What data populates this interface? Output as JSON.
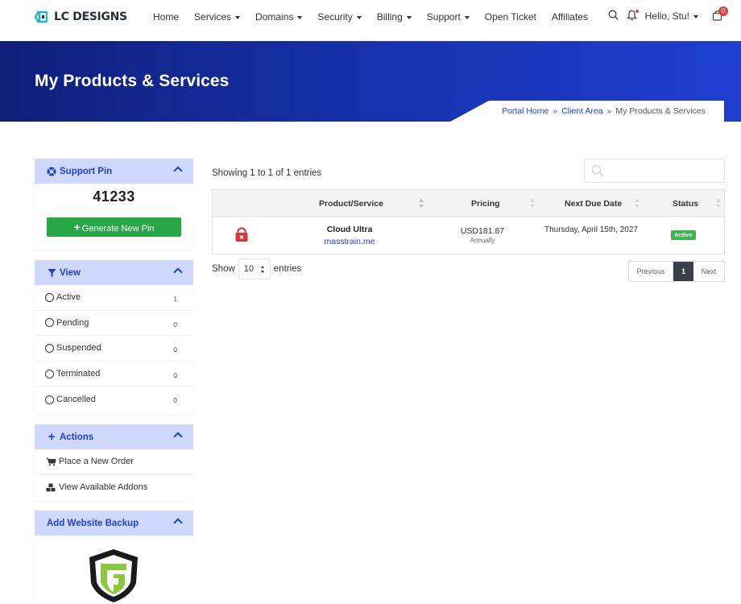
{
  "brand": {
    "name": "LC DESIGNS"
  },
  "nav": {
    "items": [
      {
        "label": "Home",
        "dropdown": false
      },
      {
        "label": "Services",
        "dropdown": true
      },
      {
        "label": "Domains",
        "dropdown": true
      },
      {
        "label": "Security",
        "dropdown": true
      },
      {
        "label": "Billing",
        "dropdown": true
      },
      {
        "label": "Support",
        "dropdown": true
      },
      {
        "label": "Open Ticket",
        "dropdown": false
      },
      {
        "label": "Affiliates",
        "dropdown": false
      }
    ],
    "greeting": "Hello, Stu!",
    "cart_count": "0"
  },
  "hero": {
    "title": "My Products & Services"
  },
  "breadcrumb": {
    "home": "Portal Home",
    "client_area": "Client Area",
    "current": "My Products & Services"
  },
  "sidebar": {
    "support_pin": {
      "title": "Support Pin",
      "value": "41233",
      "button": "Generate New Pin"
    },
    "view": {
      "title": "View",
      "items": [
        {
          "label": "Active",
          "count": "1"
        },
        {
          "label": "Pending",
          "count": "0"
        },
        {
          "label": "Suspended",
          "count": "0"
        },
        {
          "label": "Terminated",
          "count": "0"
        },
        {
          "label": "Cancelled",
          "count": "0"
        }
      ]
    },
    "actions": {
      "title": "Actions",
      "items": [
        {
          "label": "Place a New Order"
        },
        {
          "label": "View Available Addons"
        }
      ]
    },
    "backup": {
      "title": "Add Website Backup"
    }
  },
  "table": {
    "showing": "Showing 1 to 1 of 1 entries",
    "columns": {
      "product": "Product/Service",
      "pricing": "Pricing",
      "due": "Next Due Date",
      "status": "Status"
    },
    "rows": [
      {
        "product": "Cloud Ultra",
        "domain": "masstrain.me",
        "amount": "USD181.87",
        "cycle": "Annually",
        "due": "Thursday, April 15th, 2027",
        "status": "Active"
      }
    ],
    "show_label": "Show",
    "page_size": "10",
    "entries_label": "entries",
    "pager": {
      "prev": "Previous",
      "page": "1",
      "next": "Next"
    }
  },
  "colors": {
    "accent": "#1f3fd0",
    "hero_dark": "#0f1f7a",
    "success": "#28a745",
    "badge": "#3cb54a",
    "panel_header": "#cfd8ff"
  }
}
